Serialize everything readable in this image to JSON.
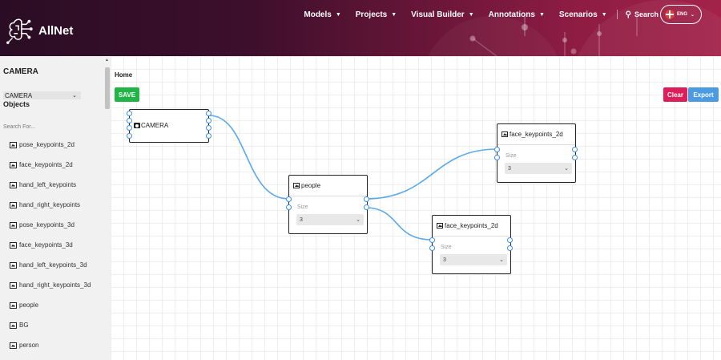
{
  "brand": {
    "name": "AllNet"
  },
  "nav": {
    "items": [
      {
        "label": "Models"
      },
      {
        "label": "Projects"
      },
      {
        "label": "Visual Builder"
      },
      {
        "label": "Annotations"
      },
      {
        "label": "Scenarios"
      }
    ],
    "search_label": "Search",
    "language": "ENG"
  },
  "sidebar": {
    "title": "CAMERA",
    "camera_select_value": "CAMERA",
    "objects_title": "Objects",
    "search_placeholder": "Search For...",
    "items": [
      "pose_keypoints_2d",
      "face_keypoints_2d",
      "hand_left_keypoints",
      "hand_right_keypoints",
      "pose_keypoints_3d",
      "face_keypoints_3d",
      "hand_left_keypoints_3d",
      "hand_right_keypoints_3d",
      "people",
      "BG",
      "person"
    ]
  },
  "canvas": {
    "breadcrumb": "Home",
    "save_label": "SAVE",
    "clear_label": "Clear",
    "export_label": "Export",
    "nodes": {
      "camera": {
        "title": "CAMERA"
      },
      "people": {
        "title": "people",
        "size_label": "Size",
        "size_value": "3"
      },
      "face1": {
        "title": "face_keypoints_2d",
        "size_label": "Size",
        "size_value": "3"
      },
      "face2": {
        "title": "face_keypoints_2d",
        "size_label": "Size",
        "size_value": "3"
      }
    }
  },
  "colors": {
    "wire": "#5aa9ea",
    "save": "#21b547",
    "clear": "#dc1f5a",
    "export": "#4a9be2"
  }
}
